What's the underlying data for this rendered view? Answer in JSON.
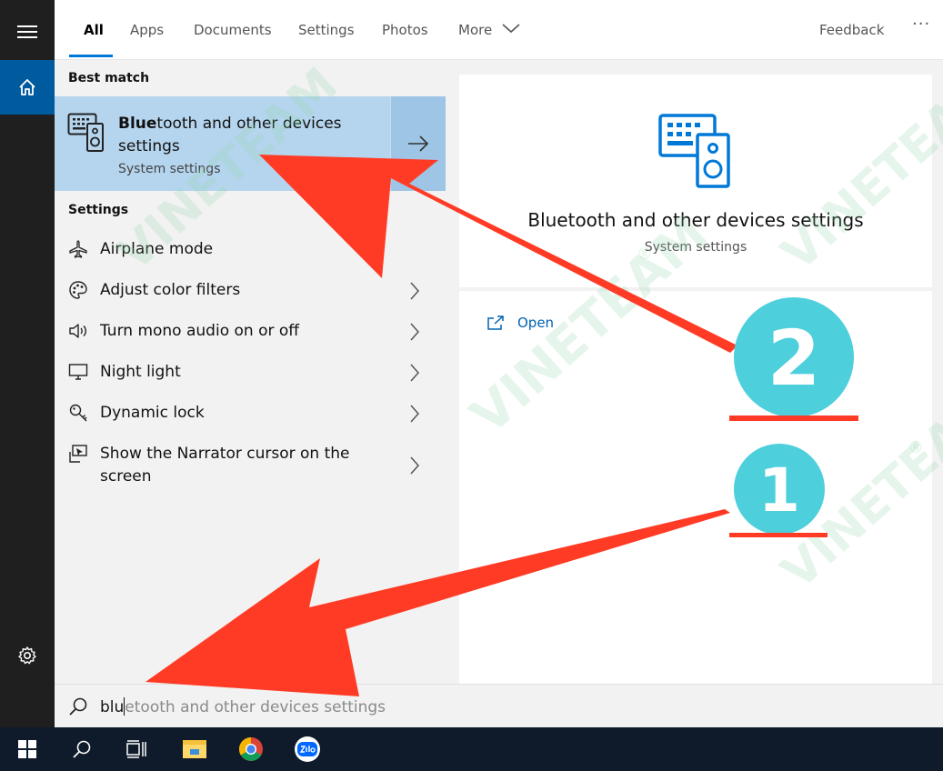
{
  "tabs": [
    {
      "label": "All",
      "active": true
    },
    {
      "label": "Apps"
    },
    {
      "label": "Documents"
    },
    {
      "label": "Settings"
    },
    {
      "label": "Photos"
    },
    {
      "label": "More"
    }
  ],
  "feedback_label": "Feedback",
  "more_options": "···",
  "best_match": {
    "section_label": "Best match",
    "title_bold": "Blue",
    "title_rest": "tooth and other devices settings",
    "subtitle": "System settings"
  },
  "settings_section": {
    "label": "Settings",
    "items": [
      {
        "label": "Airplane mode",
        "icon": "airplane-icon",
        "has_chevron": false
      },
      {
        "label": "Adjust color filters",
        "icon": "palette-icon",
        "has_chevron": true
      },
      {
        "label": "Turn mono audio on or off",
        "icon": "speaker-icon",
        "has_chevron": true
      },
      {
        "label": "Night light",
        "icon": "monitor-icon",
        "has_chevron": true
      },
      {
        "label": "Dynamic lock",
        "icon": "key-icon",
        "has_chevron": true
      },
      {
        "label": "Show the Narrator cursor on the screen",
        "icon": "narrator-icon",
        "has_chevron": true
      }
    ]
  },
  "preview": {
    "title": "Bluetooth and other devices settings",
    "subtitle": "System settings",
    "open_label": "Open"
  },
  "search": {
    "typed": "blu",
    "suggestion": "etooth and other devices settings"
  },
  "annotations": {
    "badge_1": "1",
    "badge_2": "2",
    "watermark": "VINETEAM",
    "registered_mark": "®",
    "arrow_color": "#ff3b26",
    "badge_color": "#4ecfdc"
  },
  "colors": {
    "rail": "#1f1f1f",
    "accent": "#0078d7",
    "home_active": "#005a9e",
    "best_match_bg": "#b5d5ee",
    "taskbar": "#0f1b2a"
  }
}
